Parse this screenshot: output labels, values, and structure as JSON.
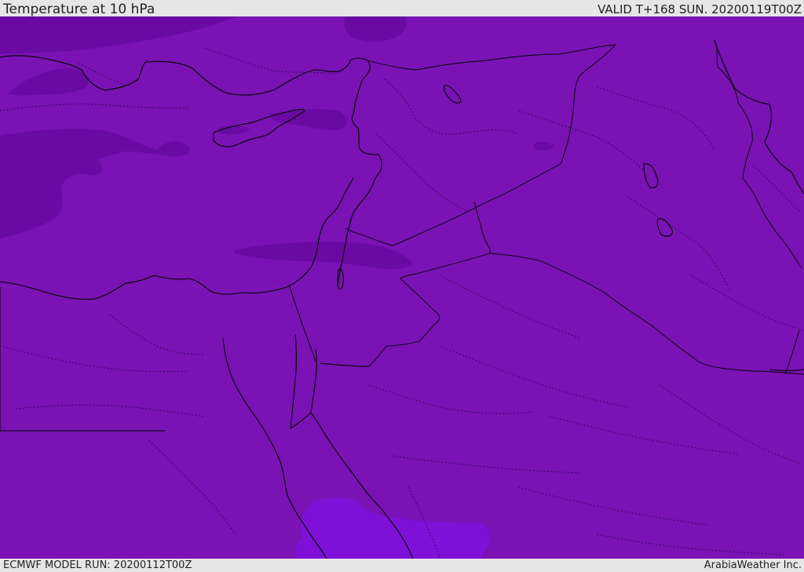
{
  "header": {
    "title": "Temperature at 10 hPa",
    "valid": "VALID T+168 SUN. 20200119T00Z"
  },
  "footer": {
    "model_run": "ECMWF MODEL RUN: 20200112T00Z",
    "brand": "ArabiaWeather Inc."
  },
  "map": {
    "region": "Eastern Mediterranean and Middle East",
    "field": "temperature at 10 hPa",
    "colors": {
      "base_fill": "#7a12b4",
      "darker_patch": "#6a0aa3",
      "brighter_patch": "#7e10d8",
      "coastline": "#000000",
      "borders": "#000000"
    },
    "shading_levels": [
      {
        "name": "base",
        "color": "#7a12b4"
      },
      {
        "name": "colder",
        "color": "#6a0aa3"
      },
      {
        "name": "warmer",
        "color": "#7e10d8"
      }
    ]
  }
}
